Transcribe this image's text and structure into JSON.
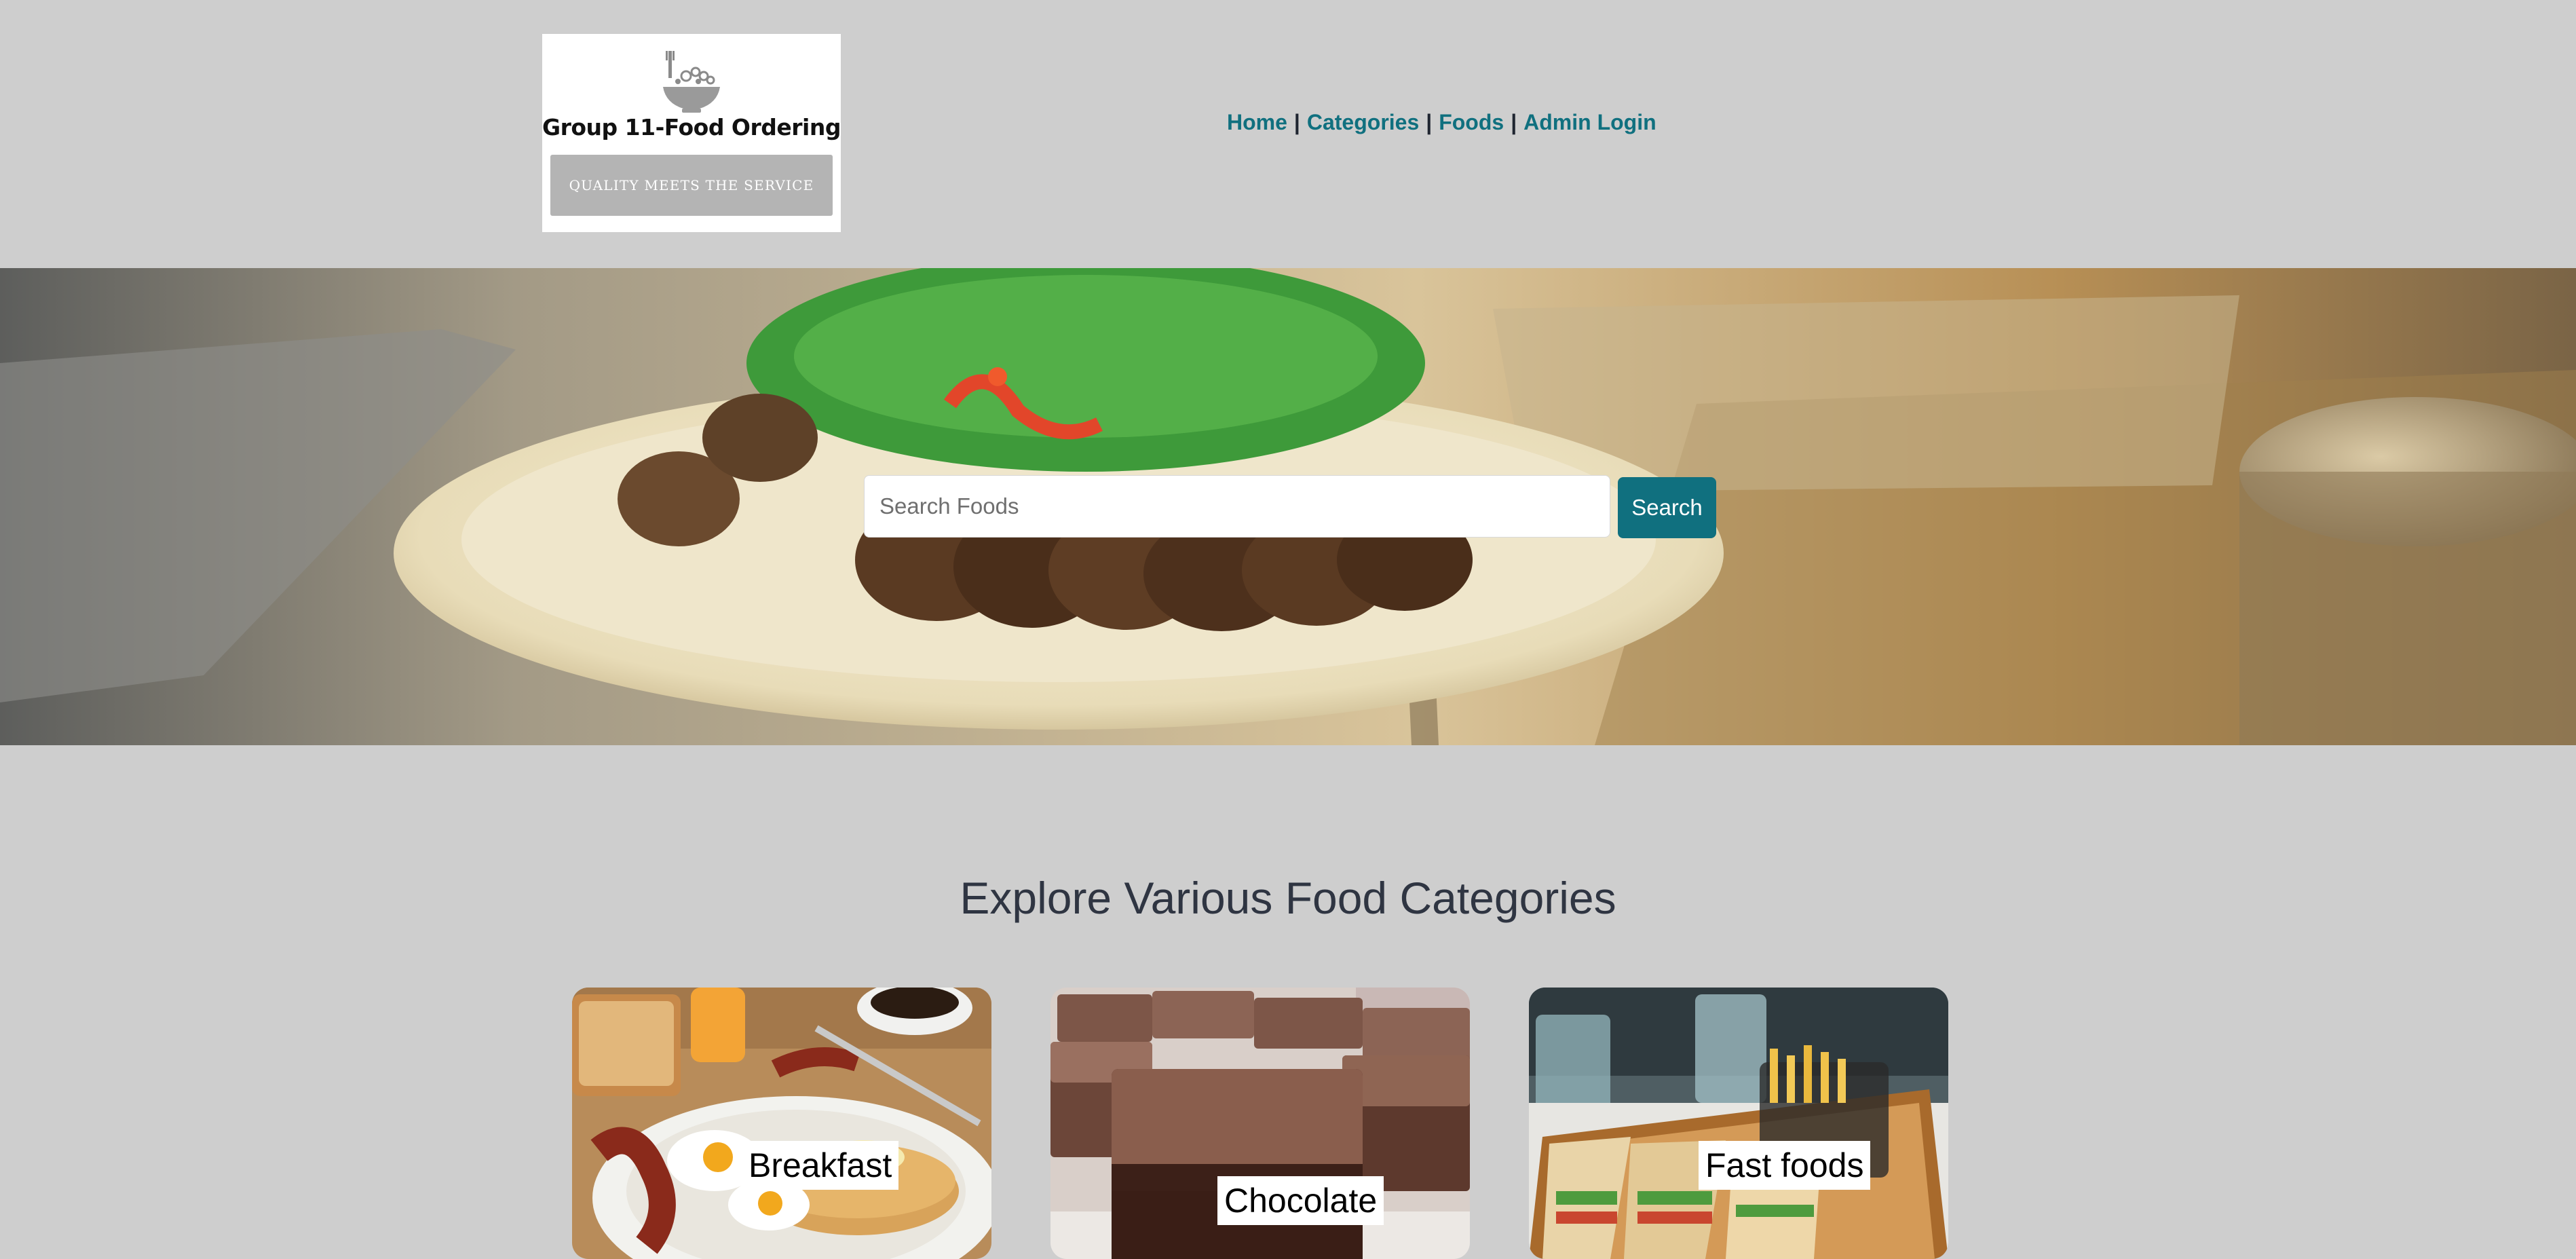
{
  "logo": {
    "title": "Group 11-Food Ordering",
    "tagline": "QUALITY MEETS THE SERVICE"
  },
  "nav": {
    "items": [
      {
        "label": "Home"
      },
      {
        "label": "Categories"
      },
      {
        "label": "Foods"
      },
      {
        "label": "Admin Login"
      }
    ],
    "separator": "|"
  },
  "search": {
    "placeholder": "Search Foods",
    "value": "",
    "button_label": "Search"
  },
  "categories": {
    "title": "Explore Various Food Categories",
    "items": [
      {
        "label": "Breakfast",
        "image": "pancakes-eggs-bacon-photo"
      },
      {
        "label": "Chocolate",
        "image": "chocolate-brownie-photo"
      },
      {
        "label": "Fast foods",
        "image": "sandwich-fries-tray-photo"
      }
    ]
  },
  "colors": {
    "page_bg": "#cecece",
    "accent": "#10707f",
    "heading": "#2f3542"
  }
}
